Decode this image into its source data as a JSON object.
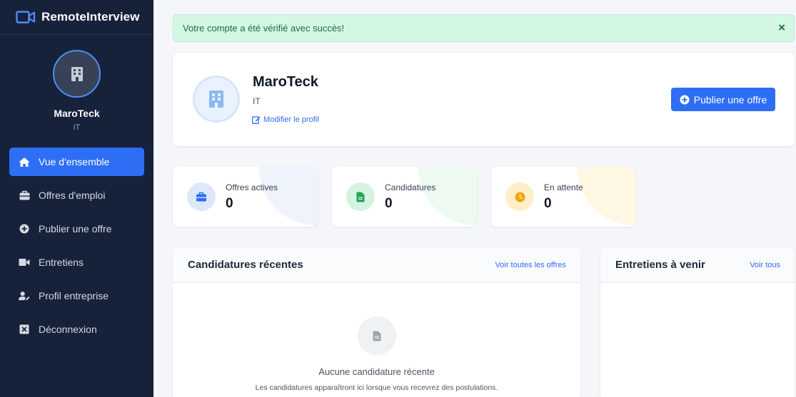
{
  "app": {
    "brand": "RemoteInterview"
  },
  "sidebar": {
    "user_name": "MaroTeck",
    "user_sector": "IT",
    "items": [
      {
        "label": "Vue d'ensemble",
        "icon": "home-icon",
        "active": true
      },
      {
        "label": "Offres d'emploi",
        "icon": "briefcase-icon",
        "active": false
      },
      {
        "label": "Publier une offre",
        "icon": "plus-circle-icon",
        "active": false
      },
      {
        "label": "Entretiens",
        "icon": "video-icon",
        "active": false
      },
      {
        "label": "Profil entreprise",
        "icon": "user-edit-icon",
        "active": false
      },
      {
        "label": "Déconnexion",
        "icon": "logout-icon",
        "active": false
      }
    ]
  },
  "alert": {
    "message": "Votre compte a été vérifié avec succès!",
    "close": "×"
  },
  "profile": {
    "name": "MaroTeck",
    "sector": "IT",
    "edit_label": "Modifier le profil",
    "publish_label": "Publier une offre"
  },
  "stats": [
    {
      "label": "Offres actives",
      "value": "0",
      "icon": "briefcase-icon",
      "color": "#2d6ef5"
    },
    {
      "label": "Candidatures",
      "value": "0",
      "icon": "file-icon",
      "color": "#22a45d"
    },
    {
      "label": "En attente",
      "value": "0",
      "icon": "clock-icon",
      "color": "#f2a60c"
    }
  ],
  "recent": {
    "title": "Candidatures récentes",
    "link": "Voir toutes les offres",
    "empty_title": "Aucune candidature récente",
    "empty_sub": "Les candidatures apparaîtront ici lorsque vous recevrez des postulations."
  },
  "upcoming": {
    "title": "Entretiens à venir",
    "link": "Voir tous"
  },
  "colors": {
    "sidebar_bg": "#16213a",
    "accent": "#2d6ef5",
    "success_bg": "#d4f7e4"
  }
}
